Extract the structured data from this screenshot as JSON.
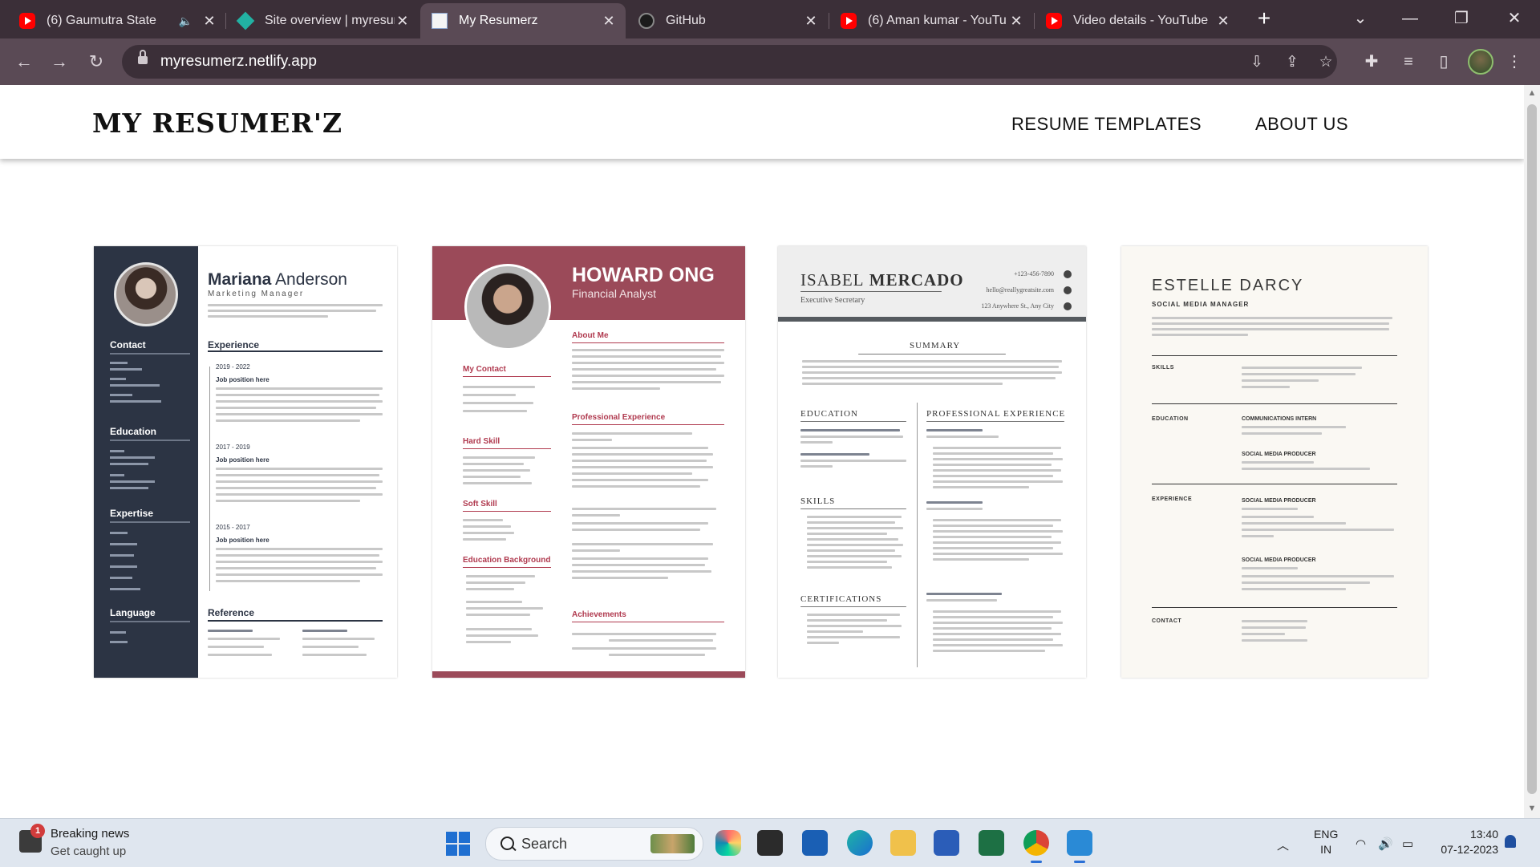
{
  "browser": {
    "tabs": [
      {
        "title": "(6) Gaumutra State",
        "favicon": "youtube-icon",
        "muted": true
      },
      {
        "title": "Site overview | myresum",
        "favicon": "netlify-icon"
      },
      {
        "title": "My Resumerz",
        "favicon": "page-icon",
        "active": true
      },
      {
        "title": "GitHub",
        "favicon": "github-icon"
      },
      {
        "title": "(6) Aman kumar - YouTu",
        "favicon": "youtube-icon"
      },
      {
        "title": "Video details - YouTube",
        "favicon": "youtube-icon"
      }
    ],
    "url": "myresumerz.netlify.app"
  },
  "site": {
    "logo": "MY RESUMER'Z",
    "nav": {
      "templates": "RESUME TEMPLATES",
      "about": "ABOUT US"
    }
  },
  "templates": [
    {
      "name_first": "Mariana",
      "name_last": " Anderson",
      "role": "Marketing Manager",
      "sidebar": {
        "contact": "Contact",
        "education": "Education",
        "expertise": "Expertise",
        "language": "Language"
      },
      "main": {
        "experience": "Experience",
        "reference": "Reference",
        "dates": [
          "2019 - 2022",
          "2017 - 2019",
          "2015 - 2017"
        ],
        "job": "Job position here"
      }
    },
    {
      "name": "HOWARD ONG",
      "role": "Financial Analyst",
      "sections": {
        "contact": "My Contact",
        "hard": "Hard Skill",
        "soft": "Soft Skill",
        "edu": "Education Background",
        "about": "About Me",
        "pro": "Professional Experience",
        "ach": "Achievements"
      }
    },
    {
      "name_first": "ISABEL",
      "name_last": " MERCADO",
      "role": "Executive Secretary",
      "phone": "+123-456-7890",
      "email": "hello@reallygreatsite.com",
      "address": "123 Anywhere St., Any City",
      "sections": {
        "summary": "SUMMARY",
        "education": "EDUCATION",
        "skills": "SKILLS",
        "certifications": "CERTIFICATIONS",
        "experience": "PROFESSIONAL EXPERIENCE"
      }
    },
    {
      "name": "ESTELLE DARCY",
      "role": "SOCIAL MEDIA MANAGER",
      "sections": {
        "skills": "SKILLS",
        "education": "EDUCATION",
        "experience": "EXPERIENCE",
        "contact": "CONTACT"
      },
      "subs": {
        "intern": "COMMUNICATIONS INTERN",
        "producer1": "SOCIAL MEDIA PRODUCER",
        "producer2": "SOCIAL MEDIA PRODUCER"
      }
    }
  ],
  "taskbar": {
    "news_title": "Breaking news",
    "news_sub": "Get caught up",
    "news_badge": "1",
    "search": "Search",
    "lang1": "ENG",
    "lang2": "IN",
    "time": "13:40",
    "date": "07-12-2023"
  }
}
